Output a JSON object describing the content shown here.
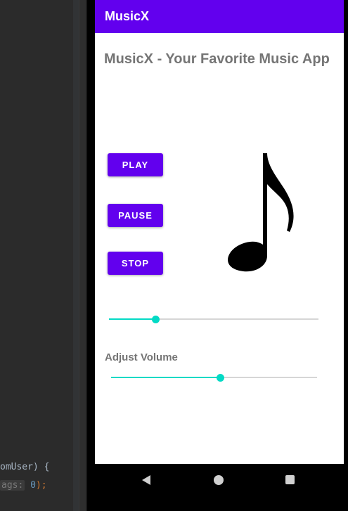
{
  "ide": {
    "line1_code": "omUser) {",
    "line2_hint": "ags:",
    "line2_value": "0",
    "line2_end": ");"
  },
  "app": {
    "title": "MusicX",
    "headline": "MusicX - Your Favorite Music App"
  },
  "controls": {
    "play_label": "PLAY",
    "pause_label": "PAUSE",
    "stop_label": "STOP"
  },
  "seekbar": {
    "progress": 0.22
  },
  "volume": {
    "label": "Adjust Volume",
    "level": 0.53
  },
  "colors": {
    "primary": "#6200ee",
    "accent": "#03dac5",
    "label_gray": "#757575"
  },
  "icons": {
    "artwork": "music-note-icon",
    "nav_back": "back-triangle-icon",
    "nav_home": "home-circle-icon",
    "nav_recent": "recents-square-icon"
  }
}
